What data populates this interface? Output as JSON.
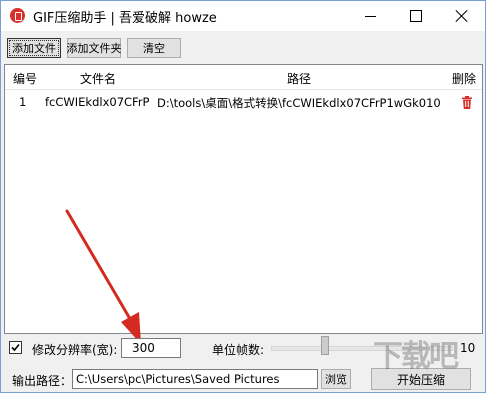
{
  "window": {
    "title": "GIF压缩助手 | 吾爱破解 howze"
  },
  "toolbar": {
    "add_file": "添加文件",
    "add_folder": "添加文件夹",
    "clear": "清空"
  },
  "list": {
    "headers": [
      "编号",
      "文件名",
      "路径",
      "删除"
    ],
    "rows": [
      {
        "num": "1",
        "name": "fcCWIEkdlx07CFrP",
        "path": "D:\\tools\\桌面\\格式转换\\fcCWIEkdlx07CFrP1wGk010"
      }
    ]
  },
  "settings": {
    "modify_resolution_label": "修改分辨率(宽):",
    "modify_resolution_checked": true,
    "width_value": "300",
    "fps_label": "单位帧数:",
    "fps_value": "10"
  },
  "output": {
    "label": "输出路径：",
    "path": "C:\\Users\\pc\\Pictures\\Saved Pictures",
    "browse": "浏览",
    "start": "开始压缩"
  },
  "watermark": "下载吧",
  "colors": {
    "accent_red": "#d8312b",
    "arrow_red": "#d42a1f"
  }
}
